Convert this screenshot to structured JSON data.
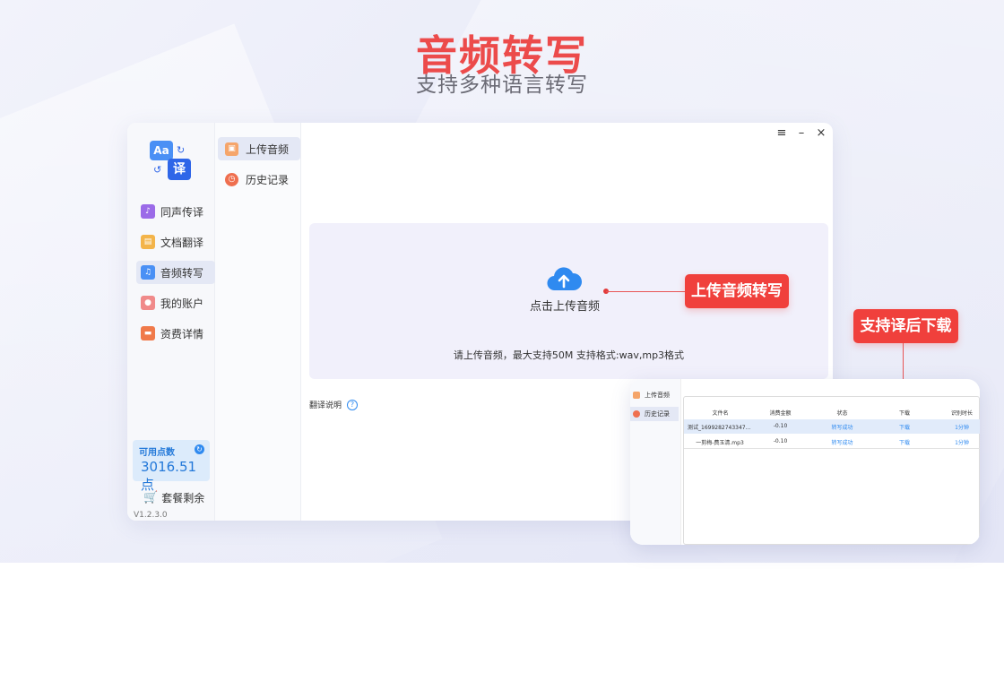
{
  "hero": {
    "title": "音频转写",
    "subtitle": "支持多种语言转写"
  },
  "sidebar": {
    "logo": {
      "text1": "Aa",
      "text2": "译"
    },
    "items": [
      {
        "label": "同声传译",
        "icon": "headset-icon"
      },
      {
        "label": "文档翻译",
        "icon": "document-icon"
      },
      {
        "label": "音频转写",
        "icon": "audio-folder-icon"
      },
      {
        "label": "我的账户",
        "icon": "user-icon"
      },
      {
        "label": "资费详情",
        "icon": "ticket-icon"
      }
    ],
    "points": {
      "label": "可用点数",
      "value": "3016.51点"
    },
    "package_label": "套餐剩余",
    "version": "V1.2.3.0"
  },
  "subnav": {
    "items": [
      {
        "label": "上传音频"
      },
      {
        "label": "历史记录"
      }
    ]
  },
  "window_controls": {
    "menu": "≡",
    "minimize": "–",
    "close": "×"
  },
  "upload": {
    "label": "点击上传音频",
    "hint": "请上传音频，最大支持50M 支持格式:wav,mp3格式"
  },
  "notes": {
    "label": "翻译说明",
    "help": "?"
  },
  "callouts": {
    "upload": "上传音频转写",
    "download": "支持译后下载"
  },
  "mini": {
    "side_items": [
      {
        "label": "上传音频"
      },
      {
        "label": "历史记录"
      }
    ],
    "headers": [
      "文件名",
      "消费金额",
      "状态",
      "下载",
      "识别时长"
    ],
    "rows": [
      [
        "测试_1699282743347...",
        "-0.10",
        "转写成功",
        "下载",
        "1分钟"
      ],
      [
        "一剪梅-费玉清.mp3",
        "-0.10",
        "转写成功",
        "下载",
        "1分钟"
      ]
    ]
  },
  "colors": {
    "accent": "#f0403c",
    "primary_blue": "#2f8af0",
    "title_red": "#ec4b4b"
  }
}
